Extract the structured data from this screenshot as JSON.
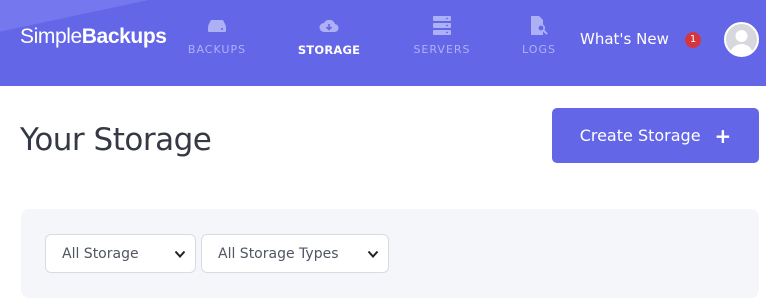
{
  "brand": {
    "logo_light": "Simple",
    "logo_bold": "Backups"
  },
  "nav": {
    "items": [
      {
        "label": "BACKUPS",
        "icon": "server-drive-icon",
        "active": false
      },
      {
        "label": "STORAGE",
        "icon": "cloud-download-icon",
        "active": true
      },
      {
        "label": "SERVERS",
        "icon": "server-stack-icon",
        "active": false
      },
      {
        "label": "LOGS",
        "icon": "document-search-icon",
        "active": false
      }
    ]
  },
  "header": {
    "whats_new": "What's New",
    "notification_count": "1"
  },
  "main": {
    "title": "Your Storage",
    "create_button": "Create Storage",
    "filters": {
      "storage_select": "All Storage",
      "type_select": "All Storage Types"
    }
  },
  "colors": {
    "brand": "#6466e8",
    "badge": "#d5363e",
    "panel": "#f4f6fa"
  }
}
